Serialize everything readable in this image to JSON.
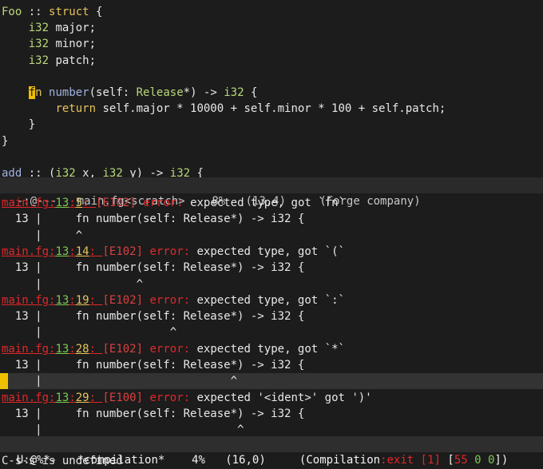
{
  "editor": {
    "lines": [
      {
        "parts": [
          {
            "t": "Foo",
            "c": "ty"
          },
          {
            "t": " :: "
          },
          {
            "t": "struct",
            "c": "kw"
          },
          {
            "t": " {"
          }
        ]
      },
      {
        "parts": [
          {
            "t": "    "
          },
          {
            "t": "i32",
            "c": "ty"
          },
          {
            "t": " major;"
          }
        ]
      },
      {
        "parts": [
          {
            "t": "    "
          },
          {
            "t": "i32",
            "c": "ty"
          },
          {
            "t": " minor;"
          }
        ]
      },
      {
        "parts": [
          {
            "t": "    "
          },
          {
            "t": "i32",
            "c": "ty"
          },
          {
            "t": " patch;"
          }
        ]
      },
      {
        "parts": [
          {
            "t": ""
          }
        ]
      },
      {
        "parts": [
          {
            "t": "    "
          },
          {
            "t": "f",
            "c": "caret"
          },
          {
            "t": "n",
            "c": "kw"
          },
          {
            "t": " "
          },
          {
            "t": "number",
            "c": "fn"
          },
          {
            "t": "(self: "
          },
          {
            "t": "Release",
            "c": "ty"
          },
          {
            "t": "*) -> "
          },
          {
            "t": "i32",
            "c": "ty"
          },
          {
            "t": " {"
          }
        ]
      },
      {
        "parts": [
          {
            "t": "        "
          },
          {
            "t": "return",
            "c": "kw"
          },
          {
            "t": " self.major * 10000 + self.minor * 100 + self.patch;"
          }
        ]
      },
      {
        "parts": [
          {
            "t": "    }"
          }
        ]
      },
      {
        "parts": [
          {
            "t": "}"
          }
        ]
      },
      {
        "parts": [
          {
            "t": ""
          }
        ]
      },
      {
        "parts": [
          {
            "t": "add",
            "c": "fn"
          },
          {
            "t": " :: ("
          },
          {
            "t": "i32",
            "c": "ty"
          },
          {
            "t": " x, "
          },
          {
            "t": "i32",
            "c": "ty"
          },
          {
            "t": " y) -> "
          },
          {
            "t": "i32",
            "c": "ty"
          },
          {
            "t": " {"
          }
        ]
      }
    ]
  },
  "modeline_top": {
    "status": "-:@---",
    "buffer": "main.fg<scratch>",
    "percent": "8%",
    "position": "(13,4)",
    "mode": "(Forge company)"
  },
  "compilation": {
    "errors": [
      {
        "file": "main.fg",
        "line": "13",
        "col": "5",
        "code": "[E102]",
        "word": "error:",
        "msg": "expected type, got `fn`",
        "src": "  13 |     fn number(self: Release*) -> i32 {",
        "caret": "     |     ^"
      },
      {
        "file": "main.fg",
        "line": "13",
        "col": "14",
        "code": "[E102]",
        "word": "error:",
        "msg": "expected type, got `(`",
        "src": "  13 |     fn number(self: Release*) -> i32 {",
        "caret": "     |              ^"
      },
      {
        "file": "main.fg",
        "line": "13",
        "col": "19",
        "code": "[E102]",
        "word": "error:",
        "msg": "expected type, got `:`",
        "src": "  13 |     fn number(self: Release*) -> i32 {",
        "caret": "     |                   ^"
      },
      {
        "file": "main.fg",
        "line": "13",
        "col": "28",
        "code": "[E102]",
        "word": "error:",
        "msg": "expected type, got `*`",
        "src": "  13 |     fn number(self: Release*) -> i32 {",
        "caret": "     |                            ^"
      },
      {
        "file": "main.fg",
        "line": "13",
        "col": "29",
        "code": "[E100]",
        "word": "error:",
        "msg": "expected '<ident>' got ')'",
        "src": "  13 |     fn number(self: Release*) -> i32 {",
        "caret": "     |                             ^"
      }
    ]
  },
  "modeline_bottom": {
    "status": "U:@%*-",
    "buffer": "*compilation*",
    "percent": "4%",
    "position": "(16,0)",
    "mode_prefix": "(Compilation",
    "mode_exit": ":exit [1]",
    "counts_open": "[",
    "count_errors": "55",
    "count_warnings": "0",
    "count_info": "0",
    "counts_close": "])"
  },
  "minibuffer": {
    "message": "C-s-s is undefined"
  }
}
